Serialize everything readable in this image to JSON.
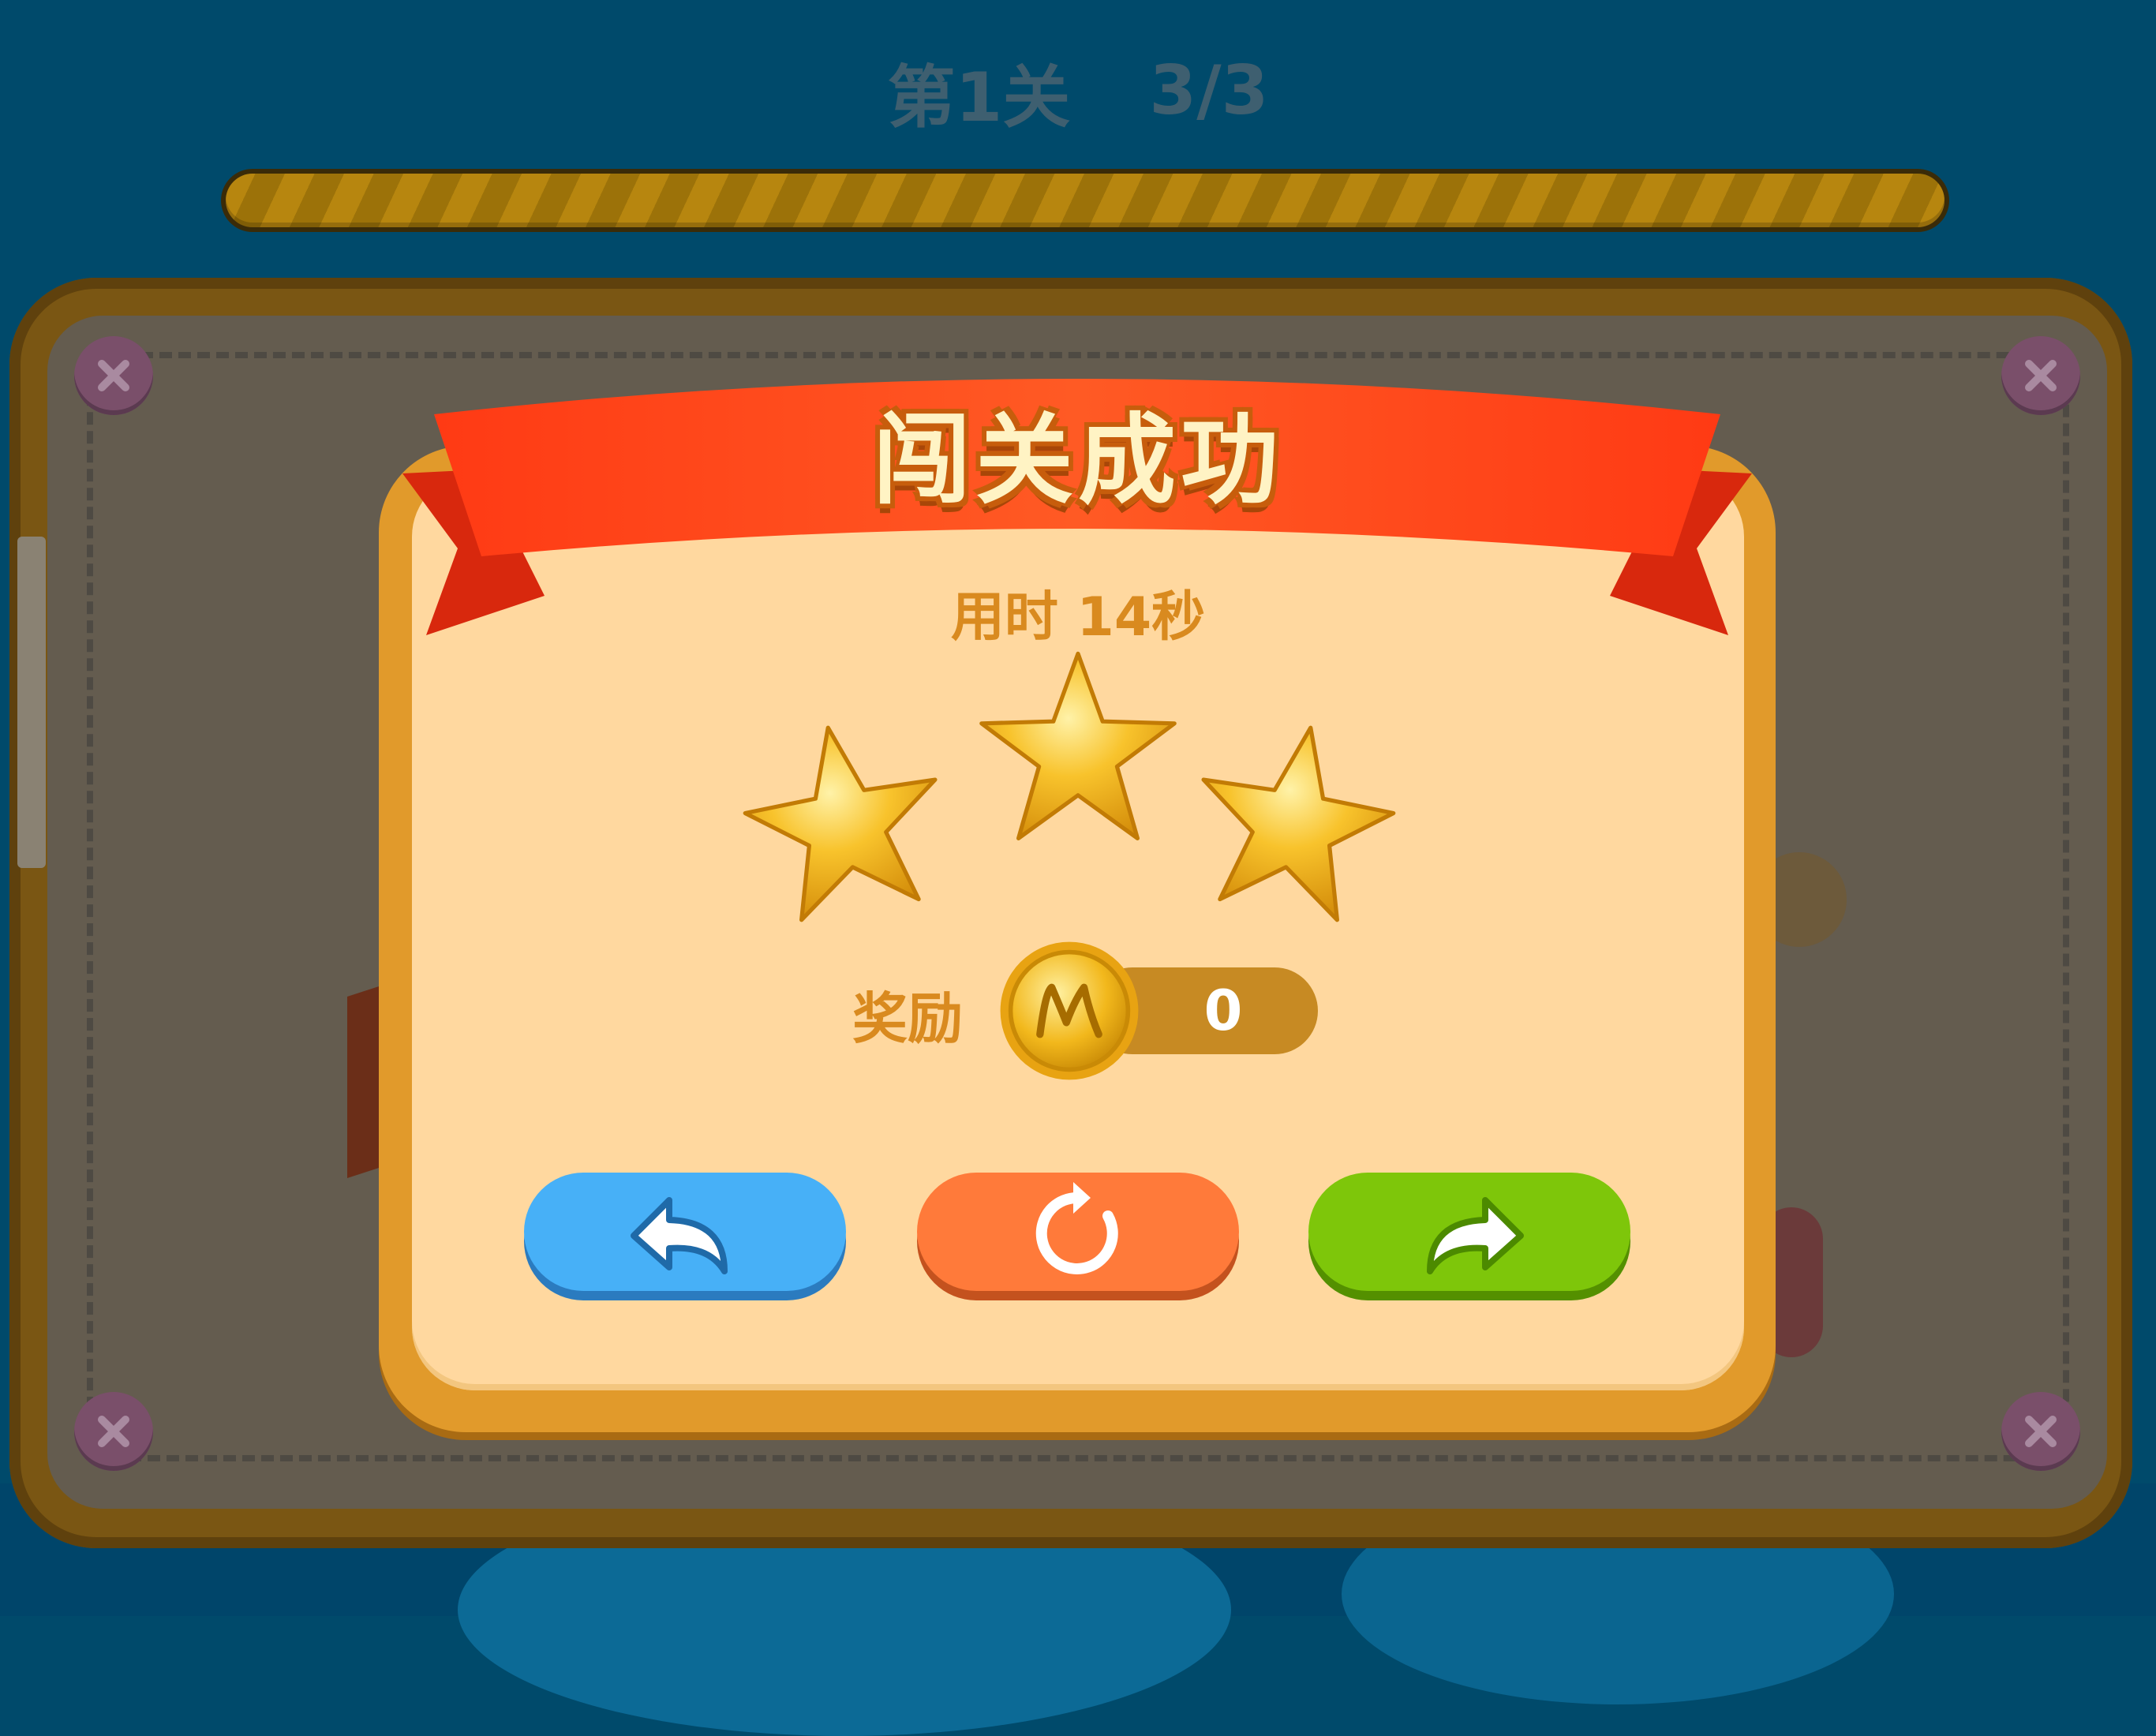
{
  "header": {
    "level_label": "第1关",
    "progress_text": "3/3",
    "progress_value": 1.0
  },
  "dialog": {
    "title": "闯关成功",
    "time_text": "用时 14秒",
    "stars_earned": 3,
    "stars_total": 3,
    "reward_label": "奖励",
    "coin_value": "0",
    "coin_icon": "coin-m-icon"
  },
  "buttons": {
    "back_icon": "back-arrow-icon",
    "retry_icon": "replay-icon",
    "next_icon": "next-arrow-icon"
  },
  "colors": {
    "background": "#004a6b",
    "dialog_border": "#e19a2b",
    "dialog_fill": "#ffd89f",
    "ribbon": "#ff4a1c",
    "back_button": "#47b0f7",
    "retry_button": "#ff7a3a",
    "next_button": "#7ec60a",
    "star": "#f4b31f"
  }
}
